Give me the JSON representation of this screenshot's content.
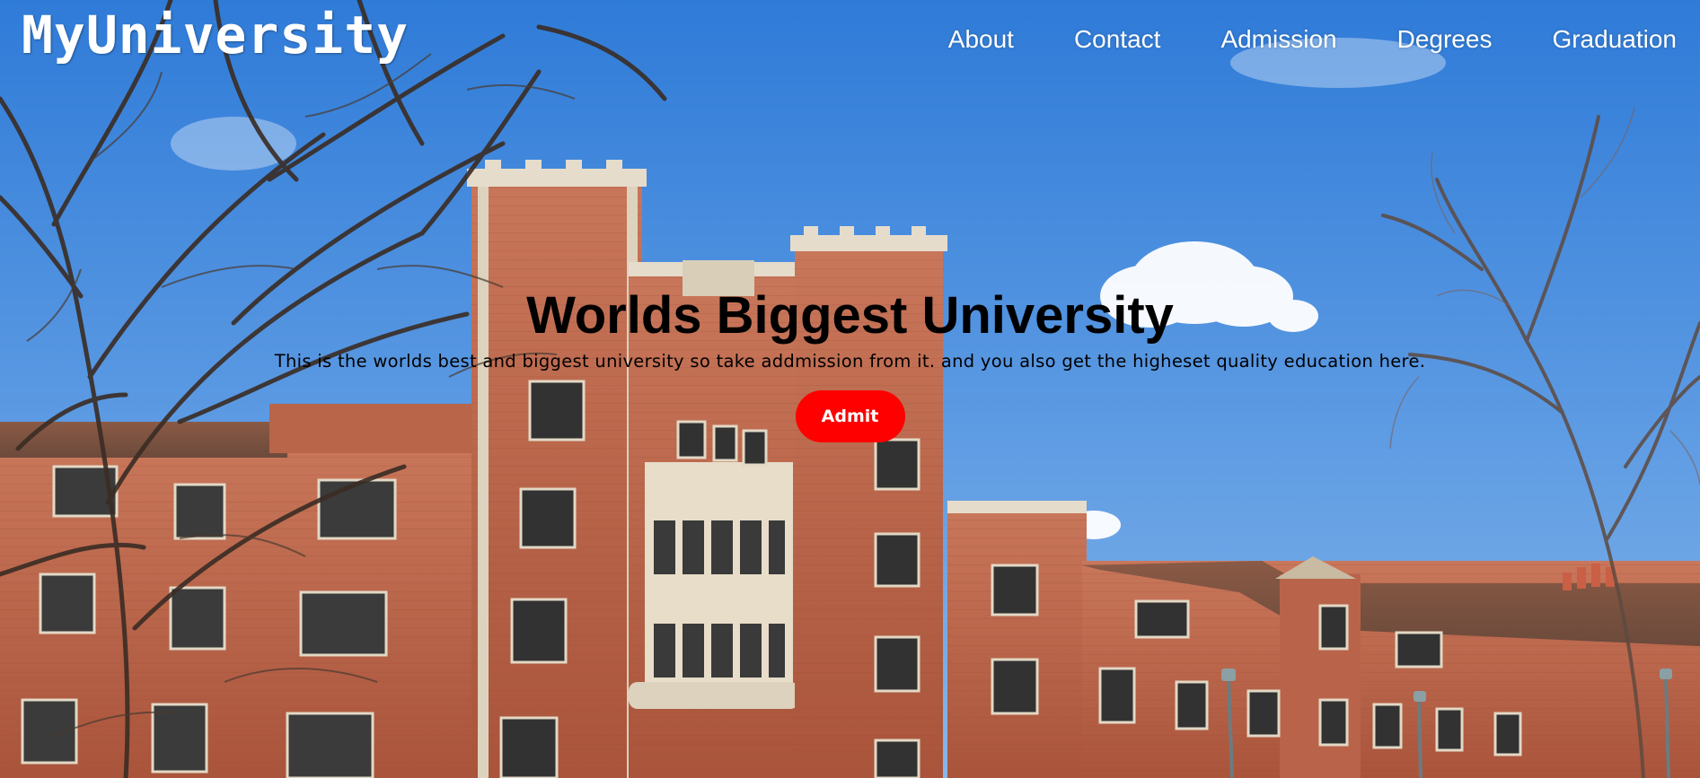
{
  "header": {
    "logo": "MyUniversity",
    "nav": [
      {
        "label": "About"
      },
      {
        "label": "Contact"
      },
      {
        "label": "Admission"
      },
      {
        "label": "Degrees"
      },
      {
        "label": "Graduation"
      }
    ]
  },
  "hero": {
    "background": "photo-university-building",
    "title": "Worlds Biggest University",
    "description": "This is the worlds best and biggest university so take addmission from it. and you also get the higheset quality education here.",
    "cta_label": "Admit"
  },
  "colors": {
    "cta": "#ff0000",
    "nav_text": "#ffffff",
    "headline": "#000000",
    "sky": "#4a8fdc"
  }
}
